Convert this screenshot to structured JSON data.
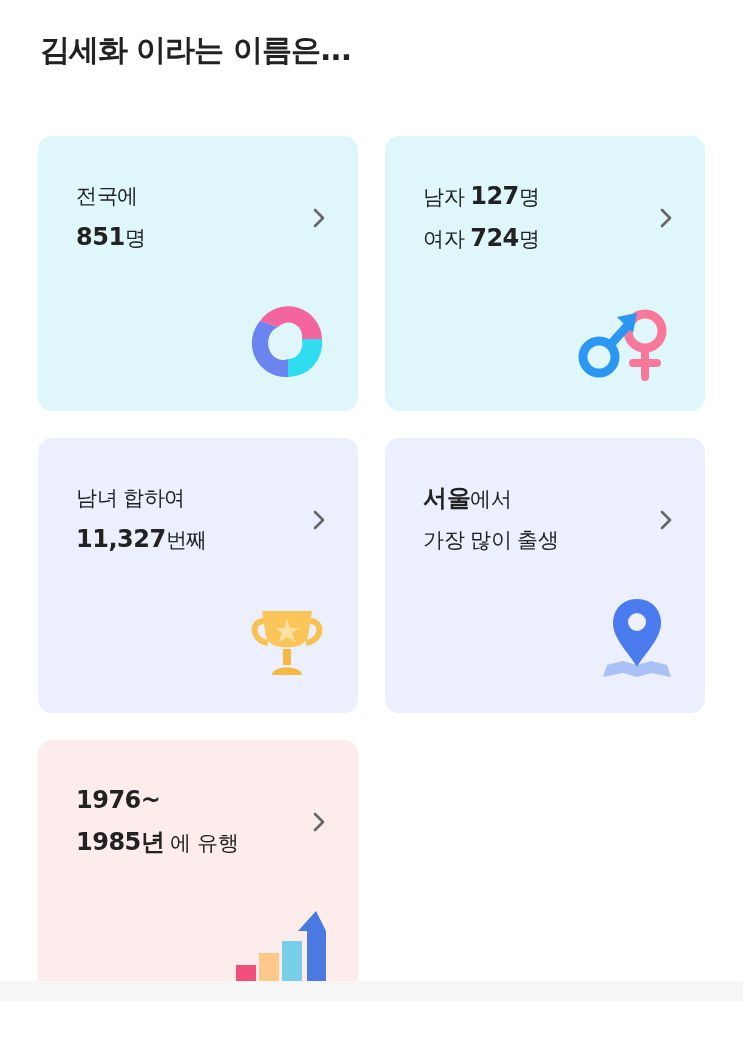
{
  "title": "김세화 이라는 이름은...",
  "cards": [
    {
      "lines": [
        "전국에",
        "**851**명"
      ],
      "color": "#dff7fb",
      "kind": "donut"
    },
    {
      "lines": [
        "남자 **127**명",
        "여자 **724**명"
      ],
      "color": "#dff7fb",
      "kind": "gender"
    },
    {
      "lines": [
        "남녀 합하여",
        "**11,327**번째"
      ],
      "color": "#eceffd",
      "kind": "trophy"
    },
    {
      "lines": [
        "**서울**에서",
        "가장 많이 출생"
      ],
      "color": "#eceffd",
      "kind": "pin"
    },
    {
      "lines": [
        "**1976~**",
        "**1985년** 에 유행"
      ],
      "color": "#fdecec",
      "kind": "growth"
    }
  ]
}
